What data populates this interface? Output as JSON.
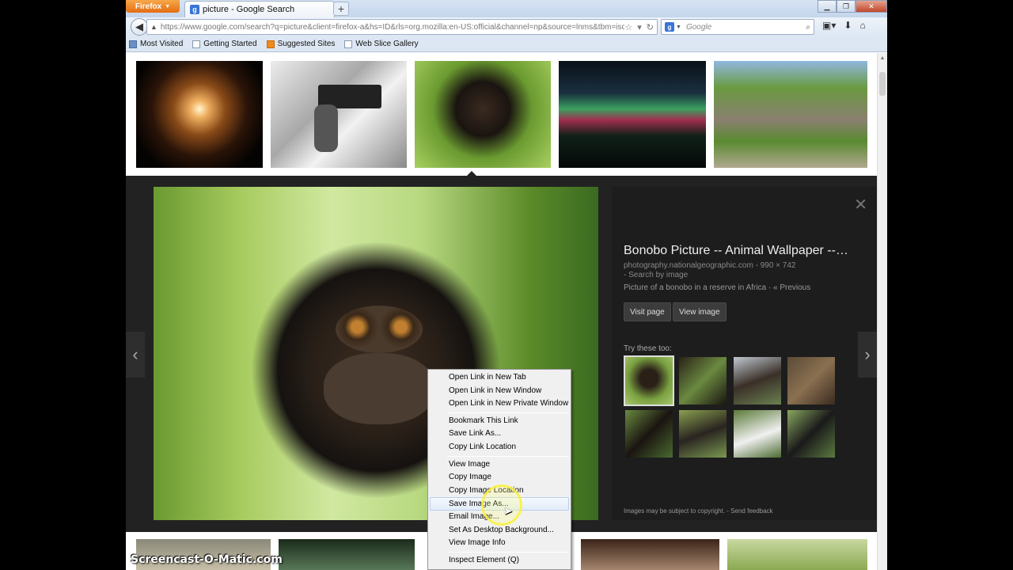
{
  "window": {
    "app_menu_label": "Firefox",
    "tab_title": "picture - Google Search",
    "new_tab_label": "+",
    "minimize": "▁",
    "restore": "❐",
    "close": "✕"
  },
  "navigation": {
    "url": "https://www.google.com/search?q=picture&client=firefox-a&hs=ID&rls=org.mozilla:en-US:official&channel=np&source=lnms&tbm=isch&sa=",
    "search_placeholder": "Google"
  },
  "bookmarks": [
    {
      "label": "Most Visited",
      "icon": "bookmarks-icon"
    },
    {
      "label": "Getting Started",
      "icon": "page-icon"
    },
    {
      "label": "Suggested Sites",
      "icon": "suggested-icon"
    },
    {
      "label": "Web Slice Gallery",
      "icon": "page-icon"
    }
  ],
  "preview": {
    "title": "Bonobo Picture -- Animal Wallpaper --…",
    "source": "photography.nationalgeographic.com - 990 × 742",
    "search_by_image": "- Search by image",
    "description": "Picture of a bonobo in a reserve in Africa · « Previous",
    "visit_page": "Visit page",
    "view_image": "View image",
    "try_these": "Try these too:",
    "footer_text": "Images may be subject to copyright.",
    "send_feedback": "- Send feedback"
  },
  "context_menu": [
    {
      "label": "Open Link in New Tab"
    },
    {
      "label": "Open Link in New Window"
    },
    {
      "label": "Open Link in New Private Window"
    },
    {
      "label": "Bookmark This Link"
    },
    {
      "label": "Save Link As..."
    },
    {
      "label": "Copy Link Location"
    },
    {
      "label": "View Image"
    },
    {
      "label": "Copy Image"
    },
    {
      "label": "Copy Image Location"
    },
    {
      "label": "Save Image As..."
    },
    {
      "label": "Email Image..."
    },
    {
      "label": "Set As Desktop Background..."
    },
    {
      "label": "View Image Info"
    },
    {
      "label": "Inspect Element (Q)"
    }
  ],
  "watermark": "Screencast-O-Matic.com"
}
